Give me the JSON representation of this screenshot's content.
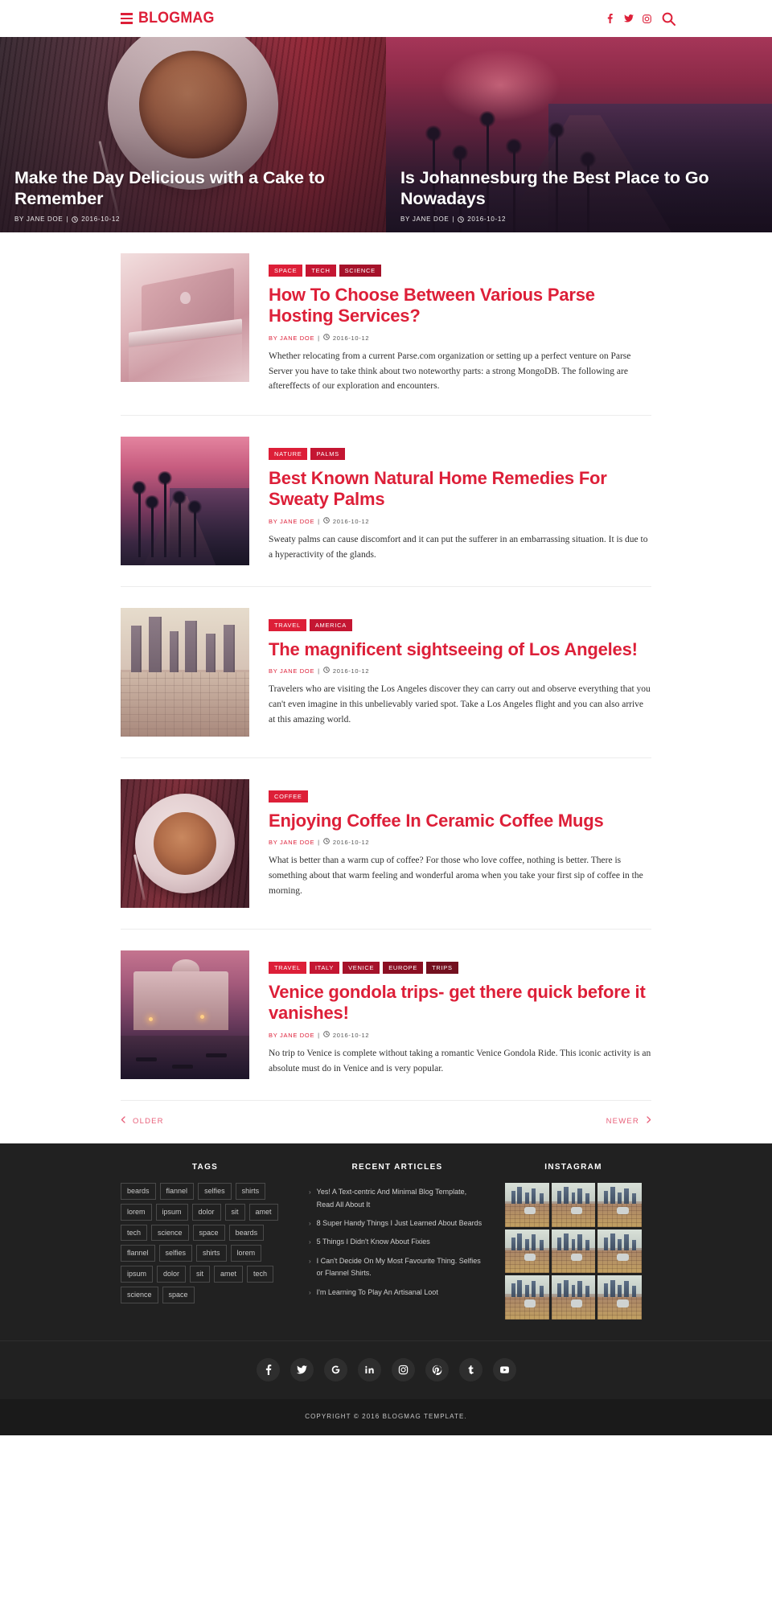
{
  "header": {
    "menu_icon": "hamburger-icon",
    "brand": "BLOGMAG",
    "social": [
      {
        "name": "facebook-icon",
        "glyph": "f"
      },
      {
        "name": "twitter-icon",
        "glyph": "t"
      },
      {
        "name": "instagram-icon",
        "glyph": "i"
      }
    ],
    "search_icon": "search-icon"
  },
  "hero": {
    "slides": [
      {
        "title": "Make the Day Delicious with a Cake to Remember",
        "author": "BY JANE DOE",
        "separator": "|",
        "date": "2016-10-12",
        "image": "coffee-cup-photo"
      },
      {
        "title": "Is Johannesburg the Best Place to Go Nowadays",
        "author": "BY JANE DOE",
        "separator": "|",
        "date": "2016-10-12",
        "image": "palm-road-sunset-photo"
      }
    ]
  },
  "posts": [
    {
      "tags": [
        "SPACE",
        "TECH",
        "SCIENCE"
      ],
      "title": "How To Choose Between Various Parse Hosting Services?",
      "author": "BY JANE DOE",
      "separator": "|",
      "date": "2016-10-12",
      "excerpt": "Whether relocating from a current Parse.com organization or setting up a perfect venture on Parse Server you have to take think about two noteworthy parts: a strong MongoDB. The following are aftereffects of our exploration and encounters.",
      "image": "laptop-photo"
    },
    {
      "tags": [
        "NATURE",
        "PALMS"
      ],
      "title": "Best Known Natural Home Remedies For Sweaty Palms",
      "author": "BY JANE DOE",
      "separator": "|",
      "date": "2016-10-12",
      "excerpt": "Sweaty palms can cause discomfort and it can put the sufferer in an embarrassing situation. It is due to a hyperactivity of the glands.",
      "image": "palms-road-photo"
    },
    {
      "tags": [
        "TRAVEL",
        "AMERICA"
      ],
      "title": "The magnificent sightseeing of Los Angeles!",
      "author": "BY JANE DOE",
      "separator": "|",
      "date": "2016-10-12",
      "excerpt": "Travelers who are visiting the Los Angeles discover they can carry out and observe everything that you can't even imagine in this unbelievably varied spot. Take a Los Angeles flight and you can also arrive at this amazing world.",
      "image": "los-angeles-skyline-photo"
    },
    {
      "tags": [
        "COFFEE"
      ],
      "title": "Enjoying Coffee In Ceramic Coffee Mugs",
      "author": "BY JANE DOE",
      "separator": "|",
      "date": "2016-10-12",
      "excerpt": "What is better than a warm cup of coffee? For those who love coffee, nothing is better. There is something about that warm feeling and wonderful aroma when you take your first sip of coffee in the morning.",
      "image": "coffee-cup-photo"
    },
    {
      "tags": [
        "TRAVEL",
        "ITALY",
        "VENICE",
        "EUROPE",
        "TRIPS"
      ],
      "title": "Venice gondola trips- get there quick before it vanishes!",
      "author": "BY JANE DOE",
      "separator": "|",
      "date": "2016-10-12",
      "excerpt": "No trip to Venice is complete without taking a romantic Venice Gondola Ride. This iconic activity is an absolute must do in Venice and is very popular.",
      "image": "venice-canal-photo"
    }
  ],
  "pagination": {
    "older_label": "OLDER",
    "newer_label": "NEWER",
    "prev_icon": "chevron-left-icon",
    "next_icon": "chevron-right-icon"
  },
  "footer": {
    "tags_title": "TAGS",
    "tags": [
      "beards",
      "flannel",
      "selfies",
      "shirts",
      "lorem",
      "ipsum",
      "dolor",
      "sit",
      "amet",
      "tech",
      "science",
      "space",
      "beards",
      "flannel",
      "selfies",
      "shirts",
      "lorem",
      "ipsum",
      "dolor",
      "sit",
      "amet",
      "tech",
      "science",
      "space"
    ],
    "recent_title": "RECENT ARTICLES",
    "recent_articles": [
      "Yes! A Text-centric And Minimal Blog Template, Read All About It",
      "8 Super Handy Things I Just Learned About Beards",
      "5 Things I Didn't Know About Fixies",
      "I Can't Decide On My Most Favourite Thing. Selfies or Flannel Shirts.",
      "I'm Learning To Play An Artisanal Loot"
    ],
    "instagram_title": "INSTAGRAM",
    "instagram_count": 9,
    "social": [
      {
        "name": "facebook-icon"
      },
      {
        "name": "twitter-icon"
      },
      {
        "name": "google-plus-icon"
      },
      {
        "name": "linkedin-icon"
      },
      {
        "name": "instagram-icon"
      },
      {
        "name": "pinterest-icon"
      },
      {
        "name": "tumblr-icon"
      },
      {
        "name": "youtube-icon"
      }
    ],
    "copyright": "COPYRIGHT © 2016 BLOGMAG TEMPLATE."
  },
  "colors": {
    "brand_red": "#dd1f38",
    "footer_bg": "#212121",
    "copyright_bg": "#1a1a1a",
    "pagination_pink": "#e8607a"
  }
}
